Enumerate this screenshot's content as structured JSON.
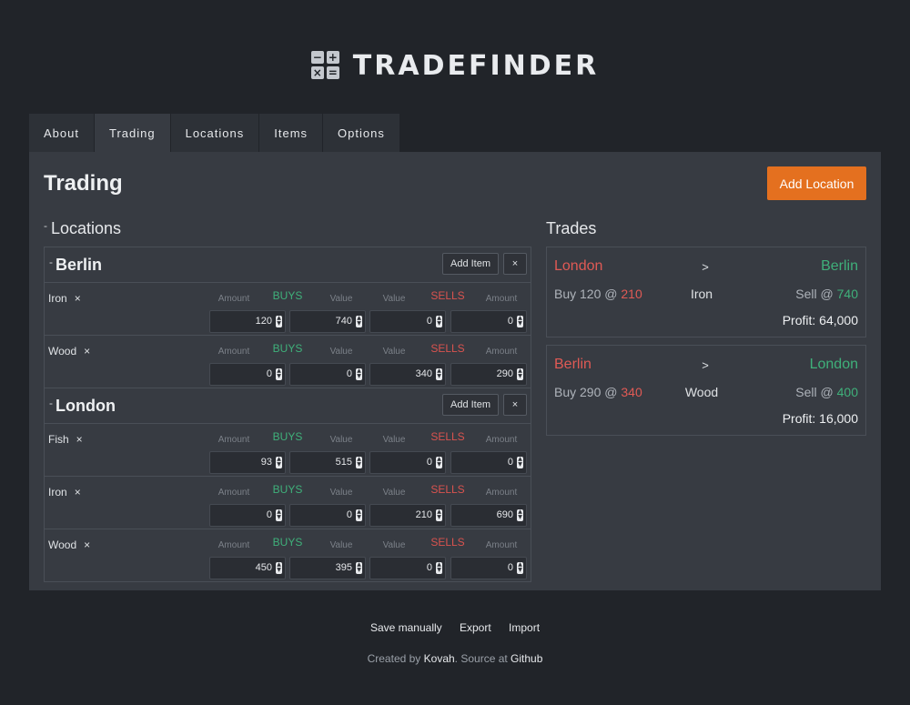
{
  "app": {
    "name": "TRADEFINDER",
    "logo_glyphs": [
      "−",
      "+",
      "×",
      "="
    ]
  },
  "tabs": [
    {
      "label": "About",
      "active": false
    },
    {
      "label": "Trading",
      "active": true
    },
    {
      "label": "Locations",
      "active": false
    },
    {
      "label": "Items",
      "active": false
    },
    {
      "label": "Options",
      "active": false
    }
  ],
  "main": {
    "title": "Trading",
    "add_location_label": "Add Location",
    "locations_heading": "Locations",
    "trades_heading": "Trades",
    "collapse_glyph": "-"
  },
  "labels": {
    "amount": "Amount",
    "value": "Value",
    "buys": "BUYS",
    "sells": "SELLS",
    "add_item": "Add Item",
    "remove": "×"
  },
  "locations": [
    {
      "name": "Berlin",
      "items": [
        {
          "name": "Iron",
          "buy_amount": "120",
          "buy_value": "740",
          "sell_value": "0",
          "sell_amount": "0"
        },
        {
          "name": "Wood",
          "buy_amount": "0",
          "buy_value": "0",
          "sell_value": "340",
          "sell_amount": "290"
        }
      ]
    },
    {
      "name": "London",
      "items": [
        {
          "name": "Fish",
          "buy_amount": "93",
          "buy_value": "515",
          "sell_value": "0",
          "sell_amount": "0"
        },
        {
          "name": "Iron",
          "buy_amount": "0",
          "buy_value": "0",
          "sell_value": "210",
          "sell_amount": "690"
        },
        {
          "name": "Wood",
          "buy_amount": "450",
          "buy_value": "395",
          "sell_value": "0",
          "sell_amount": "0"
        }
      ]
    }
  ],
  "trades": [
    {
      "from": "London",
      "arrow": ">",
      "to": "Berlin",
      "buy_prefix": "Buy 120 @",
      "buy_price": "210",
      "item": "Iron",
      "sell_prefix": "Sell @",
      "sell_price": "740",
      "profit": "Profit: 64,000"
    },
    {
      "from": "Berlin",
      "arrow": ">",
      "to": "London",
      "buy_prefix": "Buy 290 @",
      "buy_price": "340",
      "item": "Wood",
      "sell_prefix": "Sell @",
      "sell_price": "400",
      "profit": "Profit: 16,000"
    }
  ],
  "footer": {
    "links": [
      "Save manually",
      "Export",
      "Import"
    ],
    "credits_prefix": "Created by",
    "author": "Kovah",
    "credits_mid": ". Source at",
    "source": "Github"
  },
  "colors": {
    "background": "#212429",
    "panel": "#373b42",
    "accent": "#e4701f",
    "buy_green": "#3fb07a",
    "sell_red": "#d9534f"
  }
}
